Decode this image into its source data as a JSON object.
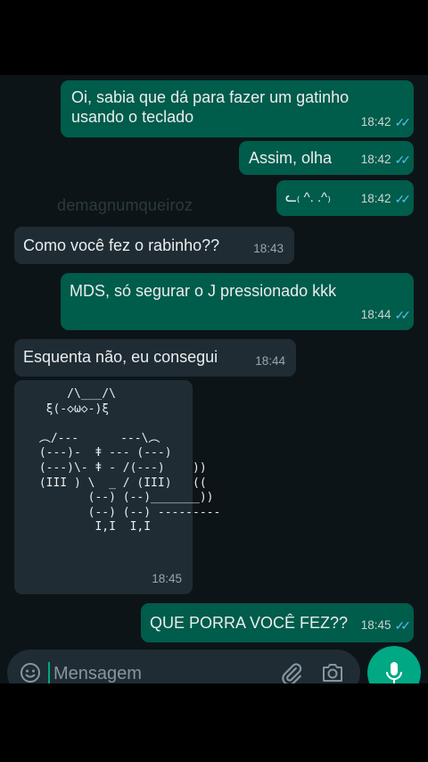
{
  "watermark": "demagnumqueiroz",
  "messages": [
    {
      "dir": "out",
      "lines": [
        "Oi, sabia que dá para fazer um gatinho",
        "usando o teclado"
      ],
      "time": "18:42",
      "ticks": "✓✓"
    },
    {
      "dir": "out",
      "text": "Assim, olha",
      "time": "18:42",
      "ticks": "✓✓"
    },
    {
      "dir": "out",
      "text": "ᓚ₍ ^. .^₎",
      "time": "18:42",
      "ticks": "✓✓"
    },
    {
      "dir": "in",
      "text": "Como você fez o rabinho??",
      "time": "18:43"
    },
    {
      "dir": "out",
      "text": "MDS, só segurar o J pressionado kkk",
      "time": "18:44",
      "ticks": "✓✓"
    },
    {
      "dir": "in",
      "text": "Esquenta não, eu consegui",
      "time": "18:44"
    },
    {
      "dir": "in",
      "art": "     /\\___/\\\n  ξ(-◇ω◇-)ξ\n\n ︵/---      ---\\︵\n (---)-  ǂ --- (---)\n (---)\\- ǂ - /(---)    ))\n (III ) \\  _ / (III)   ((\n        (--) (--)_______))\n        (--) (--) ---------\n         I,I  I,I",
      "time": "18:45"
    },
    {
      "dir": "out",
      "text": "QUE PORRA VOCÊ FEZ??",
      "time": "18:45",
      "ticks": "✓✓"
    }
  ],
  "composer": {
    "placeholder": "Mensagem"
  },
  "icons": {
    "emoji": "emoji-icon",
    "attach": "paperclip-icon",
    "camera": "camera-icon",
    "mic": "microphone-icon"
  },
  "colors": {
    "outgoing": "#005c4b",
    "incoming": "#202c33",
    "accent": "#00a884",
    "read_ticks": "#53bdeb"
  }
}
